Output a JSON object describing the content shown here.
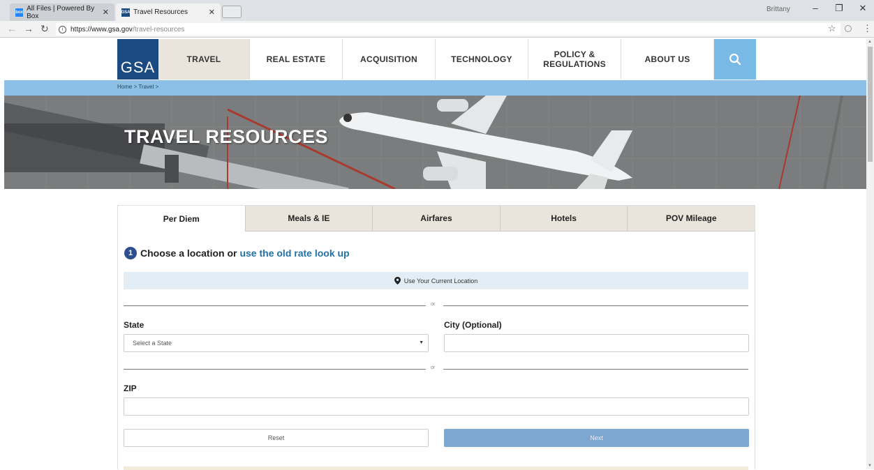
{
  "browser": {
    "tabs": [
      {
        "title": "All Files | Powered By Box",
        "icon": "box-icon",
        "color": "#2486fc"
      },
      {
        "title": "Travel Resources",
        "icon": "gsa-icon",
        "color": "#1b4a80"
      }
    ],
    "url_host": "https://www.gsa.gov",
    "url_path": "/travel-resources",
    "user": "Brittany"
  },
  "site": {
    "logo": "GSA",
    "nav": [
      "TRAVEL",
      "REAL ESTATE",
      "ACQUISITION",
      "TECHNOLOGY",
      "POLICY & REGULATIONS",
      "ABOUT US"
    ],
    "active_nav": "TRAVEL",
    "breadcrumb": "Home > Travel >",
    "hero_title": "TRAVEL RESOURCES",
    "colors": {
      "brand": "#1b4a80",
      "accent": "#79b9e6",
      "crumb": "#8dc0e6",
      "tab_bg": "#eae5dc"
    }
  },
  "tool": {
    "tabs": [
      "Per Diem",
      "Meals & IE",
      "Airfares",
      "Hotels",
      "POV Mileage"
    ],
    "active_tab": "Per Diem",
    "step_number": "1",
    "step_text": "Choose a location or",
    "step_link": "use the old rate look up",
    "location_button": "Use Your Current Location",
    "or": "or",
    "state_label": "State",
    "state_value": "Select a State",
    "city_label": "City (Optional)",
    "city_value": "",
    "zip_label": "ZIP",
    "zip_value": "",
    "reset": "Reset",
    "next": "Next"
  }
}
